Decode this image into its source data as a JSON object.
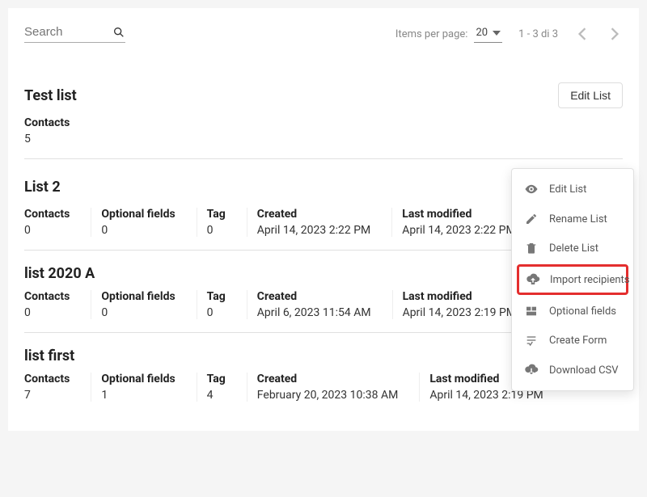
{
  "search": {
    "placeholder": "Search"
  },
  "pagination": {
    "items_per_page_label": "Items per page:",
    "items_per_page_value": "20",
    "range_text": "1 - 3 di 3"
  },
  "labels": {
    "edit_list": "Edit List"
  },
  "field_labels": {
    "contacts": "Contacts",
    "optional_fields": "Optional fields",
    "tag": "Tag",
    "created": "Created",
    "last_modified": "Last modified"
  },
  "lists": [
    {
      "title": "Test list",
      "contacts": "5"
    },
    {
      "title": "List 2",
      "contacts": "0",
      "optional_fields": "0",
      "tag": "0",
      "created": "April 14, 2023 2:22 PM",
      "last_modified": "April 14, 2023 2:22 PM",
      "has_more": true
    },
    {
      "title": "list 2020 A",
      "contacts": "0",
      "optional_fields": "0",
      "tag": "0",
      "created": "April 6, 2023 11:54 AM",
      "last_modified": "April 14, 2023 2:19 PM"
    },
    {
      "title": "list first",
      "contacts": "7",
      "optional_fields": "1",
      "tag": "4",
      "created": "February 20, 2023 10:38 AM",
      "last_modified": "April 14, 2023 2:19 PM"
    }
  ],
  "dropdown": {
    "edit": "Edit List",
    "rename": "Rename List",
    "delete": "Delete List",
    "import": "Import recipients",
    "optional": "Optional fields",
    "form": "Create Form",
    "csv": "Download CSV"
  }
}
